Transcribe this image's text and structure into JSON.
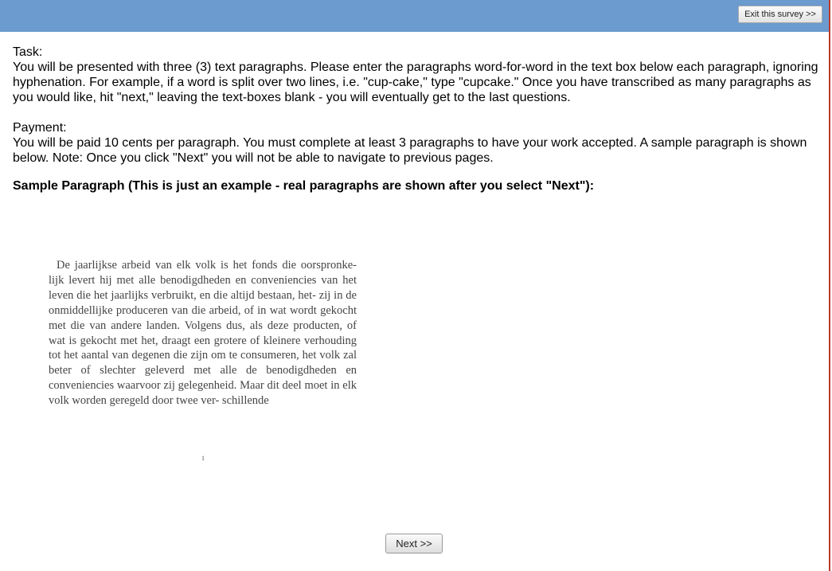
{
  "header": {
    "exit_label": "Exit this survey >>",
    "bg_color": "#6b9bcf"
  },
  "instructions": {
    "task_label": "Task:",
    "task_text": "You will be presented with three (3) text paragraphs. Please enter the paragraphs word-for-word in the text box below each paragraph, ignoring hyphenation. For example, if a word is split over two lines, i.e. \"cup-cake,\" type \"cupcake.\" Once you have transcribed as many paragraphs as you would like, hit \"next,\" leaving the text-boxes blank - you will eventually get to the last questions.",
    "payment_label": "Payment:",
    "payment_text": "You will be paid 10 cents per paragraph. You must complete at least 3 paragraphs to have your work accepted. A sample paragraph is shown below. Note: Once you click \"Next\" you will not be able to navigate to previous pages."
  },
  "sample": {
    "heading": "Sample Paragraph (This is just an example - real paragraphs are shown after you select \"Next\"):",
    "paragraph": "De jaarlijkse arbeid van elk volk is het fonds die oorspronke- lijk levert hij met alle benodigdheden en conveniencies van het leven die het jaarlijks verbruikt, en die altijd bestaan, het- zij in de onmiddellijke produceren van die arbeid, of in wat wordt gekocht met die van andere landen. Volgens dus, als deze producten, of wat is gekocht met het, draagt een grotere of kleinere verhouding tot het aantal van degenen die zijn om te consumeren, het volk zal beter of slechter geleverd met alle de benodigdheden en conveniencies waarvoor zij gelegenheid. Maar dit deel moet in elk volk worden geregeld door twee ver- schillende",
    "page_number": "1"
  },
  "footer": {
    "next_label": "Next >>"
  }
}
